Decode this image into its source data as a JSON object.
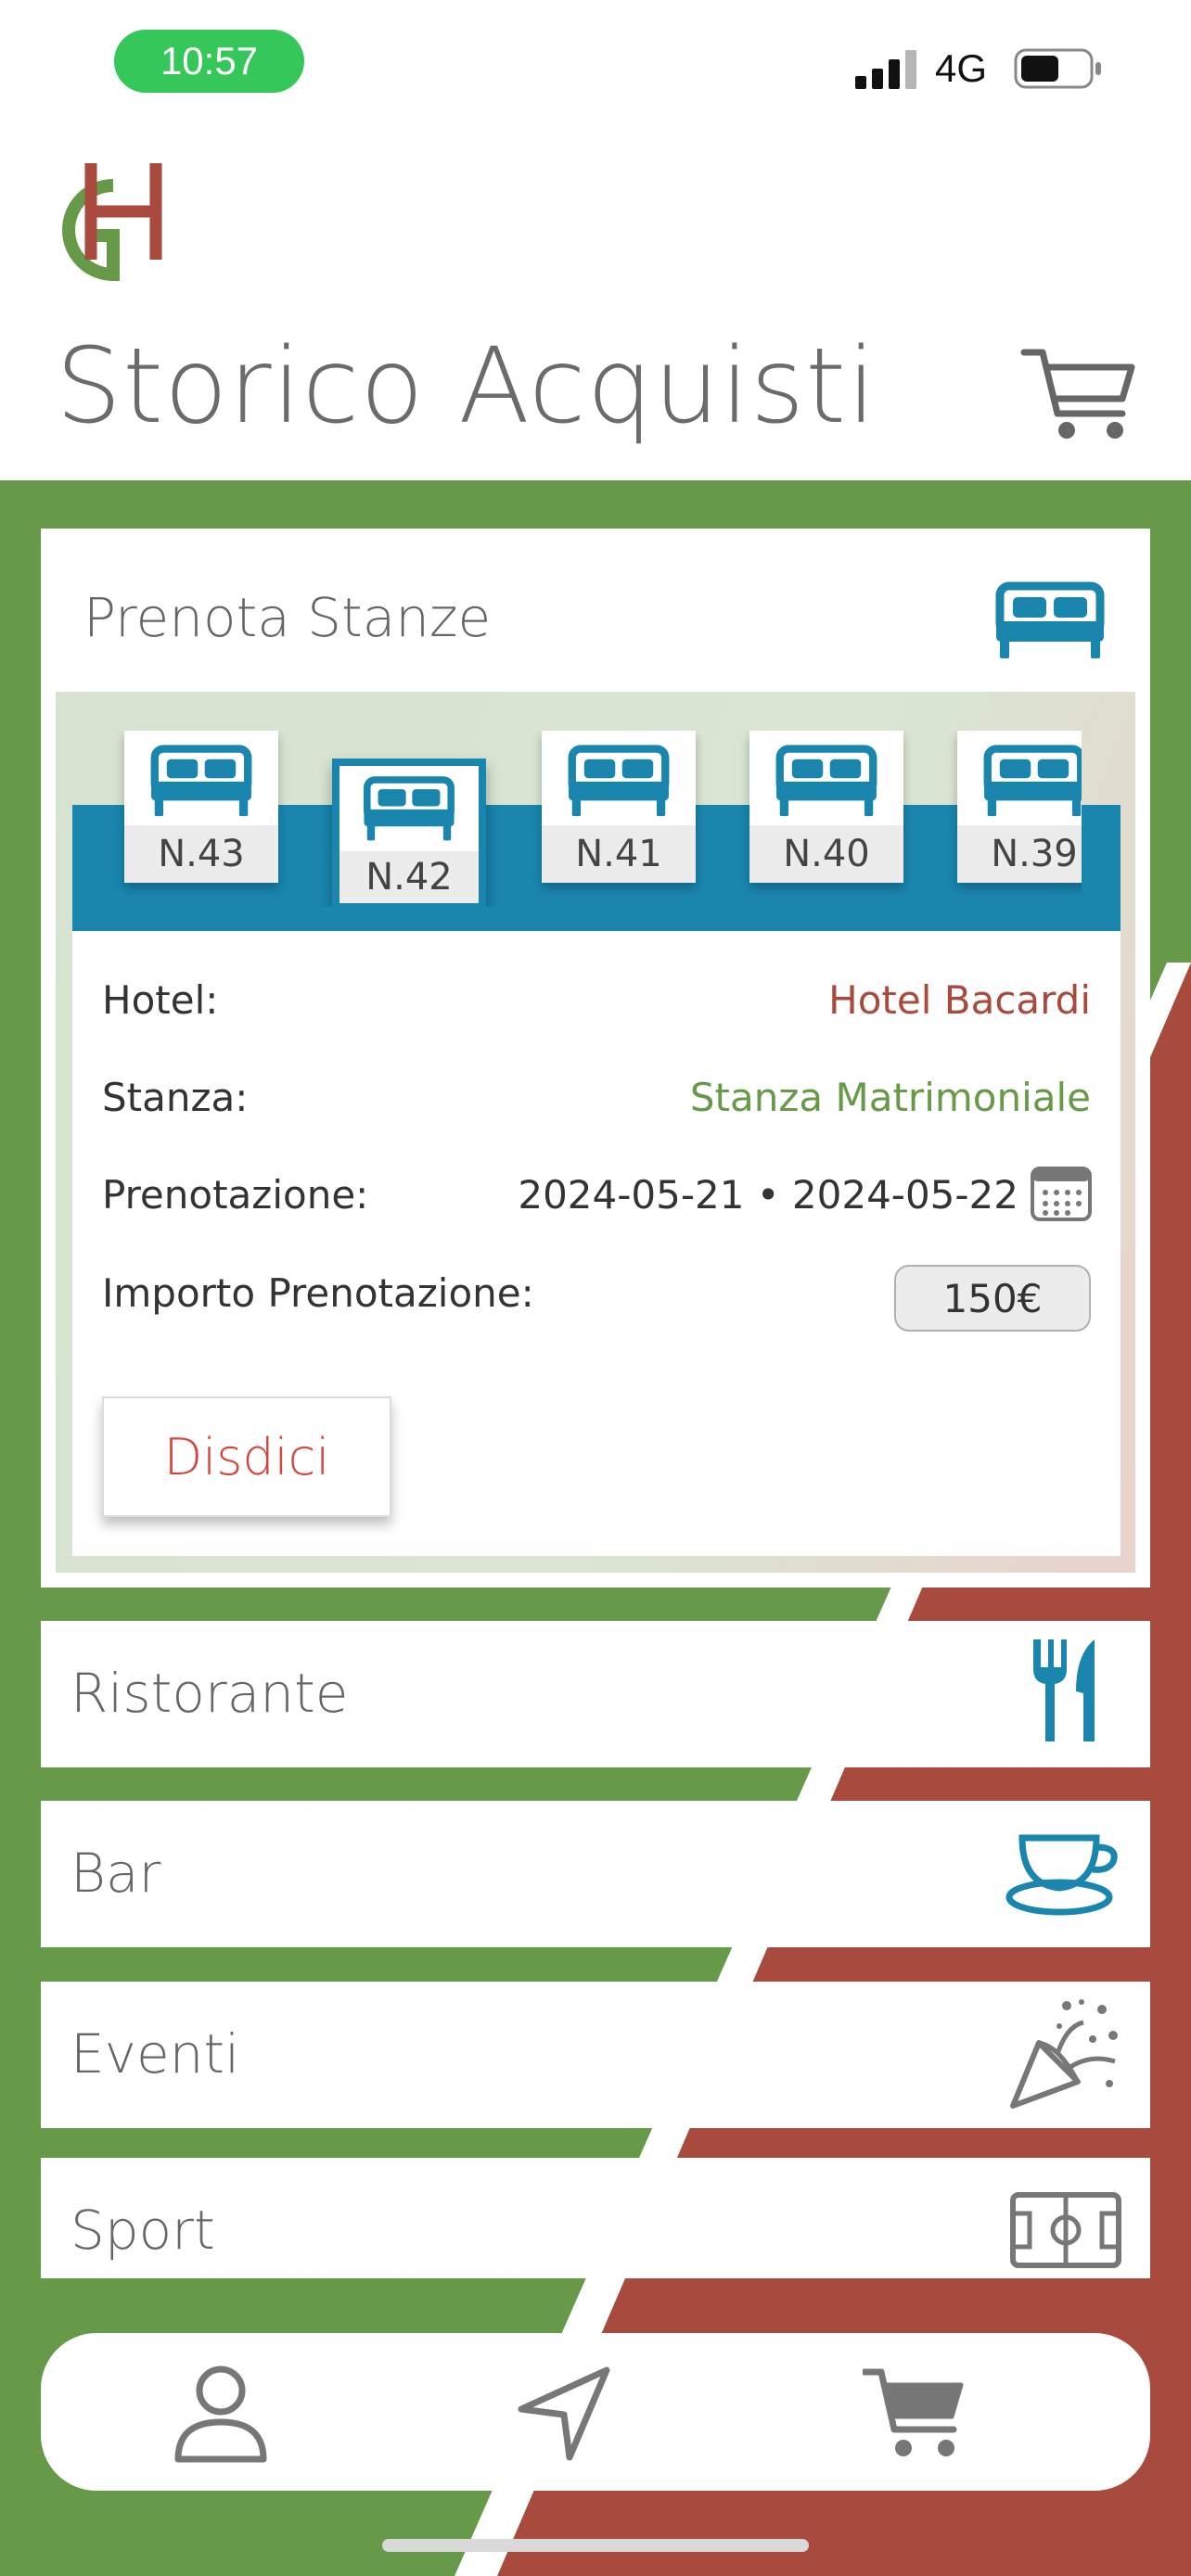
{
  "status_bar": {
    "time": "10:57",
    "network": "4G"
  },
  "header": {
    "title": "Storico Acquisti",
    "logo_icon": "gh-logo",
    "cart_icon": "cart-icon"
  },
  "colors": {
    "green": "#679a48",
    "red": "#a84a3d",
    "blue": "#1a86ae",
    "status_green": "#35c759",
    "cancel_red": "#d4453f"
  },
  "booking_card": {
    "title": "Prenota Stanze",
    "icon": "bed-icon",
    "rooms": [
      {
        "label": "N.43",
        "selected": false
      },
      {
        "label": "N.42",
        "selected": true
      },
      {
        "label": "N.41",
        "selected": false
      },
      {
        "label": "N.40",
        "selected": false
      },
      {
        "label": "N.39",
        "selected": false
      }
    ],
    "details": {
      "hotel_label": "Hotel:",
      "hotel_value": "Hotel Bacardi",
      "room_label": "Stanza:",
      "room_value": "Stanza Matrimoniale",
      "booking_label": "Prenotazione:",
      "booking_value": "2024-05-21 • 2024-05-22",
      "amount_label": "Importo Prenotazione:",
      "amount_value": "150€"
    },
    "cancel_label": "Disdici"
  },
  "sections": [
    {
      "label": "Ristorante",
      "icon": "fork-knife-icon"
    },
    {
      "label": "Bar",
      "icon": "teacup-icon"
    },
    {
      "label": "Eventi",
      "icon": "party-popper-icon"
    },
    {
      "label": "Sport",
      "icon": "soccer-field-icon"
    }
  ],
  "bottom_nav": [
    {
      "name": "profile",
      "icon": "user-icon"
    },
    {
      "name": "navigation",
      "icon": "location-arrow-icon"
    },
    {
      "name": "cart",
      "icon": "cart-icon"
    }
  ]
}
